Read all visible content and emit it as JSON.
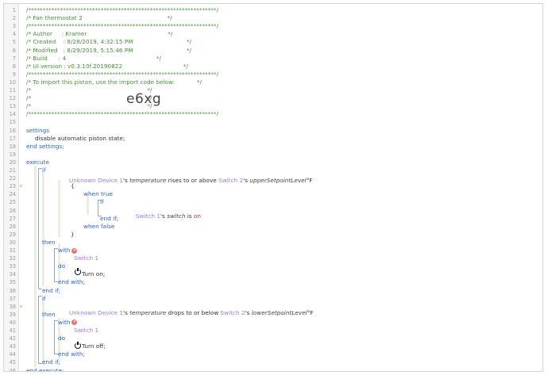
{
  "import_code": "e6xg",
  "lines": [
    {
      "n": "1",
      "text": "/*****************************************************************/",
      "cls": "c",
      "indent": 0
    },
    {
      "n": "2",
      "text": "/* Fan thermostat 2                                              */",
      "cls": "c",
      "indent": 0
    },
    {
      "n": "3",
      "text": "/*****************************************************************/",
      "cls": "c",
      "indent": 0
    },
    {
      "n": "4",
      "text": "/* Author     : Kramer                                            */",
      "cls": "c",
      "indent": 0
    },
    {
      "n": "5",
      "text": "/* Created    : 8/28/2019, 4:32:15 PM                             */",
      "cls": "c",
      "indent": 0
    },
    {
      "n": "6",
      "text": "/* Modified   : 8/29/2019, 5:15:46 PM                             */",
      "cls": "c",
      "indent": 0
    },
    {
      "n": "7",
      "text": "/* Build      : 4                                                 */",
      "cls": "c",
      "indent": 0
    },
    {
      "n": "8",
      "text": "/* UI version : v0.3.10f.20190822                                 */",
      "cls": "c",
      "indent": 0
    },
    {
      "n": "9",
      "text": "/*****************************************************************/",
      "cls": "c",
      "indent": 0
    },
    {
      "n": "10",
      "text": "/* To import this piston, use the import code below:            */",
      "cls": "c",
      "indent": 0
    },
    {
      "n": "11",
      "text": "/*                                                               */",
      "cls": "c",
      "indent": 0
    },
    {
      "n": "12",
      "text": "/*                                                               */",
      "cls": "c",
      "indent": 0
    },
    {
      "n": "13",
      "text": "/*                                                               */",
      "cls": "c",
      "indent": 0
    },
    {
      "n": "14",
      "text": "/*****************************************************************/",
      "cls": "c",
      "indent": 0
    },
    {
      "n": "15",
      "text": "",
      "cls": "pl",
      "indent": 0
    },
    {
      "n": "16",
      "text": "settings",
      "cls": "kw",
      "indent": 0
    },
    {
      "n": "17",
      "text": "disable automatic piston state;",
      "cls": "pl",
      "indent": 1
    },
    {
      "n": "18",
      "text": "end settings;",
      "cls": "kw",
      "indent": 0
    },
    {
      "n": "19",
      "text": "",
      "cls": "pl",
      "indent": 0
    },
    {
      "n": "20",
      "text": "execute",
      "cls": "kw",
      "indent": 0
    },
    {
      "n": "21",
      "text": "if",
      "cls": "kw",
      "indent": 1
    },
    {
      "n": "22",
      "text": "",
      "cls": "pl",
      "indent": 0
    },
    {
      "n": "23",
      "text": "{",
      "cls": "pl",
      "indent": 0
    },
    {
      "n": "24",
      "text": "when true",
      "cls": "kw",
      "indent": 0
    },
    {
      "n": "25",
      "text": "if",
      "cls": "kw",
      "indent": 0
    },
    {
      "n": "26",
      "text": "",
      "cls": "pl",
      "indent": 0
    },
    {
      "n": "27",
      "text": "end if;",
      "cls": "kw",
      "indent": 0
    },
    {
      "n": "28",
      "text": "when false",
      "cls": "kw",
      "indent": 0
    },
    {
      "n": "29",
      "text": "}",
      "cls": "pl",
      "indent": 0
    },
    {
      "n": "30",
      "text": "then",
      "cls": "kw",
      "indent": 0
    },
    {
      "n": "31",
      "text": "with",
      "cls": "kw",
      "indent": 0
    },
    {
      "n": "32",
      "text": "Switch 1",
      "cls": "dev",
      "indent": 0
    },
    {
      "n": "33",
      "text": "do",
      "cls": "kw",
      "indent": 0
    },
    {
      "n": "34",
      "text": "Turn on;",
      "cls": "pl",
      "indent": 0
    },
    {
      "n": "35",
      "text": "end with;",
      "cls": "kw",
      "indent": 0
    },
    {
      "n": "36",
      "text": "end if;",
      "cls": "kw",
      "indent": 0
    },
    {
      "n": "37",
      "text": "if",
      "cls": "kw",
      "indent": 0
    },
    {
      "n": "38",
      "text": "",
      "cls": "pl",
      "indent": 0
    },
    {
      "n": "39",
      "text": "then",
      "cls": "kw",
      "indent": 0
    },
    {
      "n": "40",
      "text": "with",
      "cls": "kw",
      "indent": 0
    },
    {
      "n": "41",
      "text": "Switch 1",
      "cls": "dev",
      "indent": 0
    },
    {
      "n": "42",
      "text": "do",
      "cls": "kw",
      "indent": 0
    },
    {
      "n": "43",
      "text": "Turn off;",
      "cls": "pl",
      "indent": 0
    },
    {
      "n": "44",
      "text": "end with;",
      "cls": "kw",
      "indent": 0
    },
    {
      "n": "45",
      "text": "end if;",
      "cls": "kw",
      "indent": 0
    },
    {
      "n": "46",
      "text": "end execute;",
      "cls": "kw",
      "indent": 0
    }
  ],
  "cond1": {
    "device": "Unknown Device 1",
    "s1": "'s ",
    "attr": "temperature",
    "op": " rises to or above ",
    "dev2": "Switch 2",
    "s2": "'s ",
    "var": "upperSetpointLevel",
    "unit": "°F"
  },
  "cond_inner": {
    "device": "Switch 1",
    "s1": "'s ",
    "attr": "switch",
    "op": " is ",
    "val": "on"
  },
  "cond2": {
    "device": "Unknown Device 1",
    "s1": "'s ",
    "attr": "temperature",
    "op": " drops to or below ",
    "dev2": "Switch 2",
    "s2": "'s ",
    "var": "lowerSetpointLevel",
    "unit": "°F"
  },
  "icons": {
    "trigger": "lightning-bolt-icon",
    "disabled_with": "x-circle-icon",
    "power": "power-icon"
  },
  "colors": {
    "comment": "#4a8f3e",
    "keyword": "#2a62c9",
    "device": "#a27bd6",
    "variable": "#d4941e",
    "value": "#c0392b",
    "trigger": "#e67e22"
  }
}
